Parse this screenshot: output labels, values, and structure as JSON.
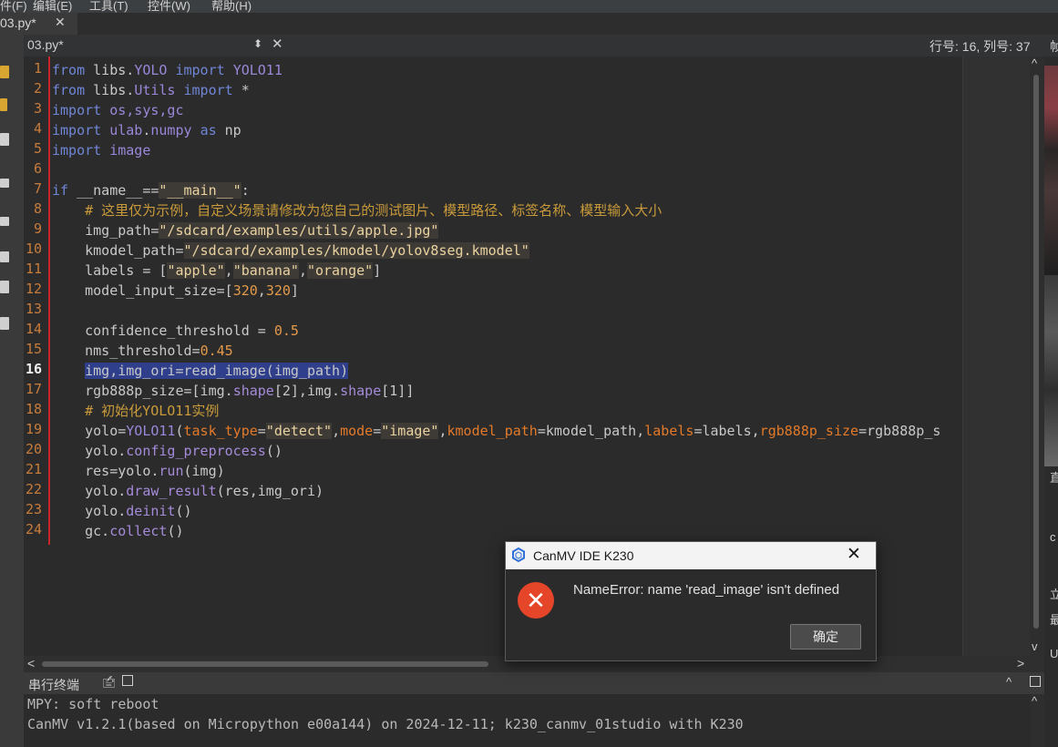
{
  "menu": {
    "items": [
      "件(F)",
      "编辑(E)",
      "工具(T)",
      "控件(W)",
      "帮助(H)"
    ]
  },
  "outer_tab": {
    "label": "03.py*",
    "close": "✕"
  },
  "editor_header": {
    "file_combo": "03.py*",
    "combo_arrow": "⬍",
    "close": "✕",
    "cursor_position": "行号: 16, 列号: 37"
  },
  "right_panel": {
    "top_char": "帧",
    "chars": [
      "直",
      "c",
      "立",
      "最",
      "U",
      "立",
      "最"
    ]
  },
  "code": {
    "current_line": 16,
    "line_numbers": [
      "1",
      "2",
      "3",
      "4",
      "5",
      "6",
      "7",
      "8",
      "9",
      "10",
      "11",
      "12",
      "13",
      "14",
      "15",
      "16",
      "17",
      "18",
      "19",
      "20",
      "21",
      "22",
      "23",
      "24"
    ],
    "tokens": {
      "from": "from",
      "import": "import",
      "as": "as",
      "if": "if",
      "libs": "libs",
      "YOLO": "YOLO",
      "Utils": "Utils",
      "YOLO11": "YOLO11",
      "star": "*",
      "os_sys_gc": "os,sys,gc",
      "ulab": "ulab",
      "numpy": "numpy",
      "np": "np",
      "image": "image",
      "name_eq": "__name__==",
      "main_str": "\"__main__\"",
      "colon": ":",
      "comment_1": "# 这里仅为示例，自定义场景请修改为您自己的测试图片、模型路径、标签名称、模型输入大小",
      "img_path_assign": "img_path=",
      "img_path_str": "\"/sdcard/examples/utils/apple.jpg\"",
      "kmodel_path_assign": "kmodel_path=",
      "kmodel_path_str": "\"/sdcard/examples/kmodel/yolov8seg.kmodel\"",
      "labels_assign": "labels = [",
      "apple": "\"apple\"",
      "banana": "\"banana\"",
      "orange": "\"orange\"",
      "comma": ",",
      "rbracket": "]",
      "model_input_assign": "model_input_size=[",
      "n320a": "320",
      "n320b": "320",
      "conf_assign": "confidence_threshold = ",
      "conf_val": "0.5",
      "nms_assign": "nms_threshold=",
      "nms_val": "0.45",
      "line16": "img,img_ori=read_image(img_path)",
      "rgb_assign": "rgb888p_size=[img.",
      "shape": "shape",
      "idx2": "[2],img.",
      "idx1": "[1]]",
      "comment_2": "# 初始化YOLO11实例",
      "yolo_assign": "yolo=",
      "yolo_cls": "YOLO11",
      "lparen": "(",
      "task_type": "task_type",
      "eq": "=",
      "detect_str": "\"detect\"",
      "mode": "mode",
      "image_str": "\"image\"",
      "kmodel_path_kw": "kmodel_path",
      "kmodel_path_val": "kmodel_path,",
      "labels_kw": "labels",
      "labels_val": "labels,",
      "rgb_kw": "rgb888p_size",
      "rgb_val": "rgb888p_s",
      "yolo_dot": "yolo.",
      "config_preprocess": "config_preprocess",
      "call_empty": "()",
      "res_assign": "res=yolo.",
      "run": "run",
      "run_args": "(img)",
      "draw_result": "draw_result",
      "draw_args": "(res,img_ori)",
      "deinit": "deinit",
      "gc_dot": "gc.",
      "collect": "collect"
    }
  },
  "scrollbar": {
    "up": "^",
    "down": "v",
    "left": "<",
    "right": ">"
  },
  "terminal": {
    "title": "串行终端",
    "icon1": "🖆",
    "collapse": "^",
    "lines": [
      "MPY: soft reboot",
      "CanMV v1.2.1(based on Micropython e00a144) on 2024-12-11; k230_canmv_01studio with K230"
    ]
  },
  "dialog": {
    "title": "CanMV IDE K230",
    "close": "✕",
    "error_icon": "✕",
    "message": "NameError: name 'read_image' isn't defined",
    "ok_label": "确定"
  },
  "colors": {
    "keyword": "#6f86d6",
    "string": "#ead3a1",
    "number": "#e39a4a",
    "comment": "#c99b3a",
    "param": "#e27a2a",
    "selection": "#2f3f8c",
    "line_number": "#c87c3c",
    "error_red": "#e5462a"
  }
}
